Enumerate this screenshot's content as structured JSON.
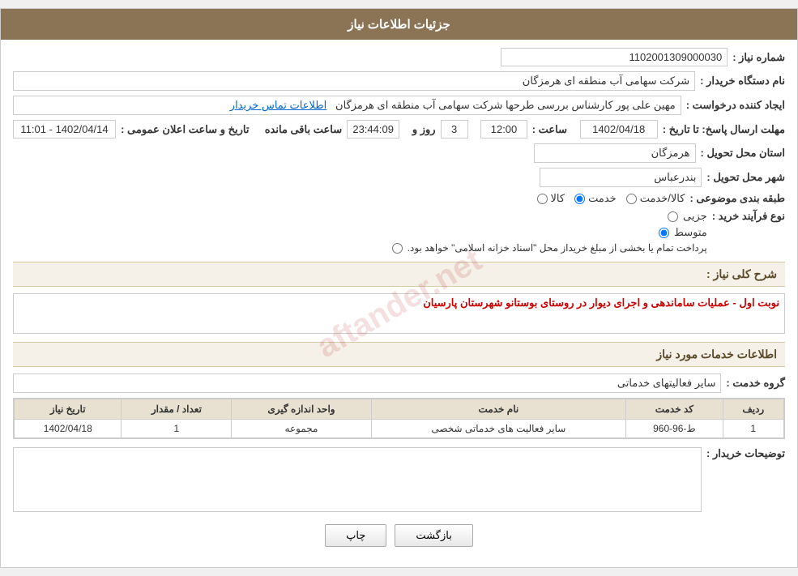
{
  "header": {
    "title": "جزئیات اطلاعات نیاز"
  },
  "fields": {
    "shomara_niaz_label": "شماره نیاز :",
    "shomara_niaz_value": "1102001309000030",
    "naam_dastgah_label": "نام دستگاه خریدار :",
    "naam_dastgah_value": "شرکت سهامی  آب منطقه ای هرمزگان",
    "eijad_label": "ایجاد کننده درخواست :",
    "eijad_value": "مهین علی پور کارشناس بررسی طرحها شرکت سهامی  آب منطقه ای هرمزگان",
    "eijad_link_text": "اطلاعات تماس خریدار",
    "tarikh_label": "مهلت ارسال پاسخ: تا تاریخ :",
    "tarikh_value": "1402/04/18",
    "saaat_label": "ساعت :",
    "saaat_value": "12:00",
    "rooz_label": "روز و",
    "rooz_value": "3",
    "baaghi_label": "ساعت باقی مانده",
    "baaghi_value": "23:44:09",
    "tarikh_elaan_label": "تاریخ و ساعت اعلان عمومی :",
    "tarikh_elaan_value": "1402/04/14 - 11:01",
    "ostan_label": "استان محل تحویل :",
    "ostan_value": "هرمزگان",
    "shahr_label": "شهر محل تحویل :",
    "shahr_value": "بندرعباس",
    "tabaqe_label": "طبقه بندی موضوعی :",
    "tabaqe_options": [
      {
        "label": "کالا",
        "selected": false
      },
      {
        "label": "خدمت",
        "selected": true
      },
      {
        "label": "کالا/خدمت",
        "selected": false
      }
    ],
    "nooe_label": "نوع فرآیند خرید :",
    "nooe_options": [
      {
        "label": "جزیی",
        "selected": false
      },
      {
        "label": "متوسط",
        "selected": true
      },
      {
        "label": "پرداخت تمام یا بخشی از مبلغ خریدار محل \"اسناد خزانه اسلامی\" خواهد بود.",
        "selected": false
      }
    ],
    "sharh_label": "شرح کلی نیاز :",
    "sharh_value": "نوبت اول - عملیات ساماندهی و اجرای دیوار در روستای بوستانو شهرستان پارسیان",
    "section2_title": "اطلاعات خدمات مورد نیاز",
    "gorooh_label": "گروه خدمت :",
    "gorooh_value": "سایر فعالیتهای خدماتی",
    "table": {
      "headers": [
        "ردیف",
        "کد خدمت",
        "نام خدمت",
        "واحد اندازه گیری",
        "تعداد / مقدار",
        "تاریخ نیاز"
      ],
      "rows": [
        {
          "radif": "1",
          "kod": "ط-96-960",
          "naam": "سایر فعالیت های خدماتی شخصی",
          "vahed": "مجموعه",
          "tedad": "1",
          "tarikh": "1402/04/18"
        }
      ]
    },
    "tozihat_label": "توضیحات خریدار :"
  },
  "buttons": {
    "print_label": "چاپ",
    "back_label": "بازگشت"
  }
}
